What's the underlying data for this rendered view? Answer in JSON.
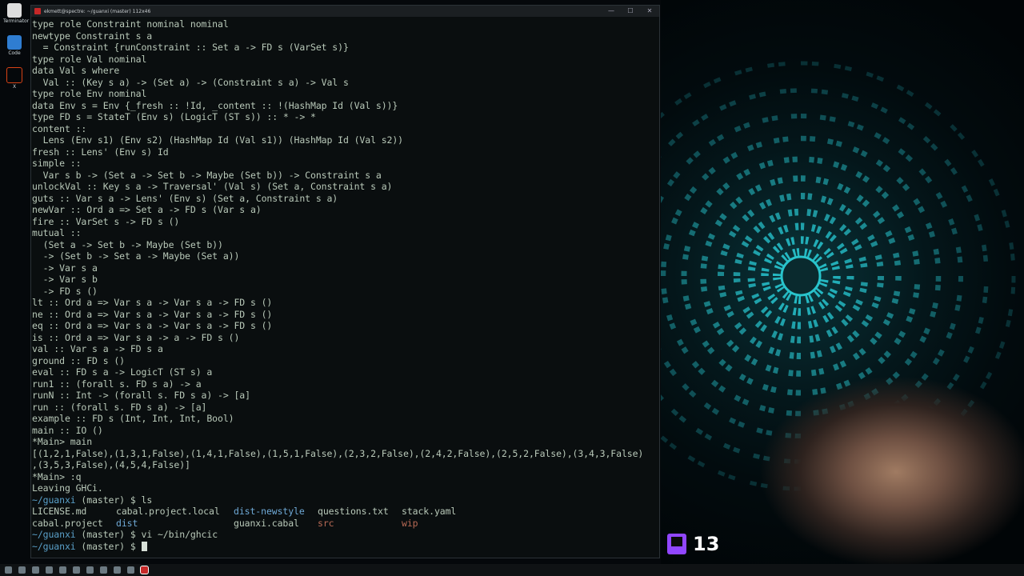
{
  "window": {
    "title": "ekmett@spectre: ~/guanxi (master) 112x46",
    "minimize": "—",
    "maximize": "☐",
    "close": "✕"
  },
  "desktop": {
    "icons": [
      {
        "label": "Terminator",
        "color": "#eeeeee"
      },
      {
        "label": "Code",
        "color": "#2f7dd1"
      },
      {
        "label": "X",
        "color": "#d84315"
      }
    ]
  },
  "terminal_lines": [
    "type role Constraint nominal nominal",
    "newtype Constraint s a",
    "  = Constraint {runConstraint :: Set a -> FD s (VarSet s)}",
    "type role Val nominal",
    "data Val s where",
    "  Val :: (Key s a) -> (Set a) -> (Constraint s a) -> Val s",
    "type role Env nominal",
    "data Env s = Env {_fresh :: !Id, _content :: !(HashMap Id (Val s))}",
    "type FD s = StateT (Env s) (LogicT (ST s)) :: * -> *",
    "content ::",
    "  Lens (Env s1) (Env s2) (HashMap Id (Val s1)) (HashMap Id (Val s2))",
    "fresh :: Lens' (Env s) Id",
    "simple ::",
    "  Var s b -> (Set a -> Set b -> Maybe (Set b)) -> Constraint s a",
    "unlockVal :: Key s a -> Traversal' (Val s) (Set a, Constraint s a)",
    "guts :: Var s a -> Lens' (Env s) (Set a, Constraint s a)",
    "newVar :: Ord a => Set a -> FD s (Var s a)",
    "fire :: VarSet s -> FD s ()",
    "mutual ::",
    "  (Set a -> Set b -> Maybe (Set b))",
    "  -> (Set b -> Set a -> Maybe (Set a))",
    "  -> Var s a",
    "  -> Var s b",
    "  -> FD s ()",
    "lt :: Ord a => Var s a -> Var s a -> FD s ()",
    "ne :: Ord a => Var s a -> Var s a -> FD s ()",
    "eq :: Ord a => Var s a -> Var s a -> FD s ()",
    "is :: Ord a => Var s a -> a -> FD s ()",
    "val :: Var s a -> FD s a",
    "ground :: FD s ()",
    "eval :: FD s a -> LogicT (ST s) a",
    "run1 :: (forall s. FD s a) -> a",
    "runN :: Int -> (forall s. FD s a) -> [a]",
    "run :: (forall s. FD s a) -> [a]",
    "example :: FD s (Int, Int, Int, Bool)",
    "main :: IO ()",
    "*Main> main",
    "[(1,2,1,False),(1,3,1,False),(1,4,1,False),(1,5,1,False),(2,3,2,False),(2,4,2,False),(2,5,2,False),(3,4,3,False)",
    ",(3,5,3,False),(4,5,4,False)]",
    "*Main> :q",
    "Leaving GHCi."
  ],
  "shell": {
    "path": "~/guanxi",
    "branch": "(master)",
    "dollar": "$",
    "cmd1": "ls",
    "ls_row1": {
      "a": "LICENSE.md",
      "b": "cabal.project.local",
      "c": "dist-newstyle",
      "d": "questions.txt",
      "e": "stack.yaml"
    },
    "ls_row2": {
      "a": "cabal.project",
      "b": "dist",
      "c": "guanxi.cabal",
      "d": "src",
      "e": "wip"
    },
    "cmd2": "vi ~/bin/ghcic"
  },
  "twitch": {
    "viewer_count": "13",
    "brand_color": "#9146ff"
  },
  "colors": {
    "terminal_bg": "#0a0e0f",
    "terminal_fg": "#b9c9b9",
    "prompt_path": "#5aa0c9",
    "directory": "#6fa9d6"
  }
}
